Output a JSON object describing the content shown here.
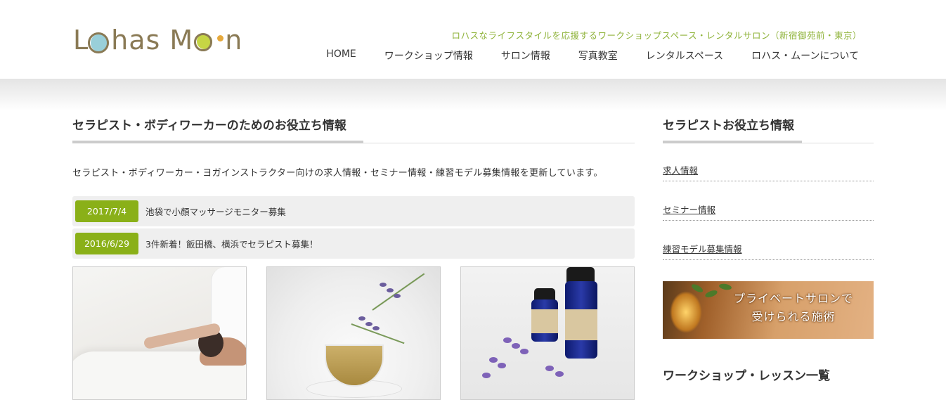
{
  "header": {
    "logo_text": "Lohas Moon",
    "tagline": "ロハスなライフスタイルを応援するワークショップスペース・レンタルサロン（新宿御苑前・東京）",
    "nav": [
      {
        "label": "HOME"
      },
      {
        "label": "ワークショップ情報"
      },
      {
        "label": "サロン情報"
      },
      {
        "label": "写真教室"
      },
      {
        "label": "レンタルスペース"
      },
      {
        "label": "ロハス・ムーンについて"
      }
    ]
  },
  "main": {
    "title": "セラピスト・ボディワーカーのためのお役立ち情報",
    "intro": "セラピスト・ボディワーカー・ヨガインストラクター向けの求人情報・セミナー情報・練習モデル募集情報を更新しています。",
    "news": [
      {
        "date": "2017/7/4",
        "text": "池袋で小顔マッサージモニター募集"
      },
      {
        "date": "2016/6/29",
        "text": "3件新着！飯田橋、横浜でセラピスト募集！"
      }
    ]
  },
  "sidebar": {
    "title": "セラピストお役立ち情報",
    "links": [
      {
        "label": "求人情報"
      },
      {
        "label": "セミナー情報"
      },
      {
        "label": "練習モデル募集情報"
      }
    ],
    "banner": {
      "line1": "プライベートサロンで",
      "line2": "受けられる施術"
    },
    "next_title": "ワークショップ・レッスン一覧"
  },
  "colors": {
    "accent_green": "#8ab018",
    "tagline_green": "#8fb33a",
    "logo_brown": "#8a7a55"
  }
}
